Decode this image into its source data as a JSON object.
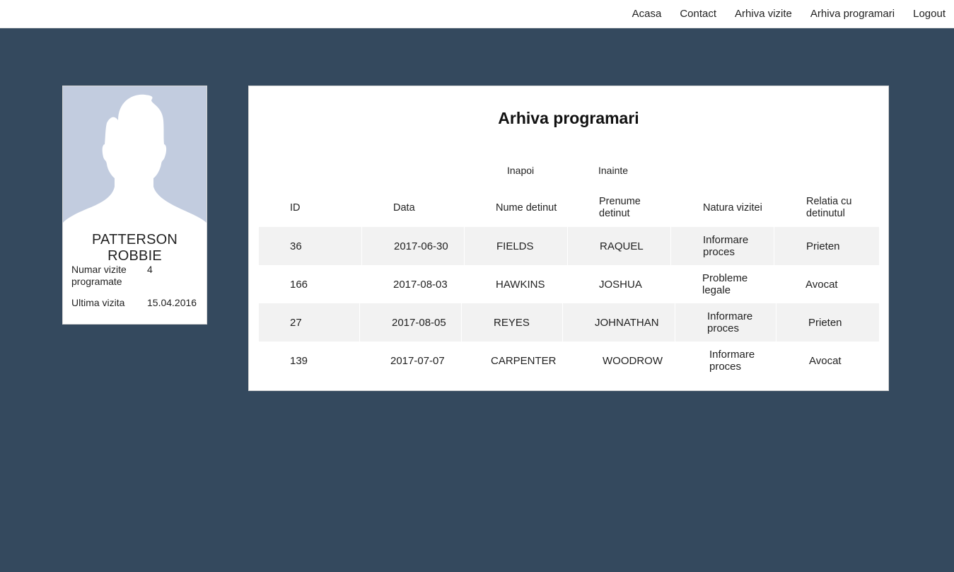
{
  "nav": {
    "items": [
      "Acasa",
      "Contact",
      "Arhiva vizite",
      "Arhiva programari",
      "Logout"
    ]
  },
  "profile": {
    "name": "PATTERSON ROBBIE",
    "stats": [
      {
        "label": "Numar vizite programate",
        "value": "4"
      },
      {
        "label": "Ultima vizita",
        "value": "15.04.2016"
      }
    ]
  },
  "panel": {
    "title": "Arhiva programari",
    "prev_label": "Inapoi",
    "next_label": "Inainte",
    "columns": [
      "ID",
      "Data",
      "Nume detinut",
      "Prenume detinut",
      "Natura vizitei",
      "Relatia cu detinutul"
    ],
    "rows": [
      [
        "36",
        "2017-06-30",
        "FIELDS",
        "RAQUEL",
        "Informare proces",
        "Prieten"
      ],
      [
        "166",
        "2017-08-03",
        "HAWKINS",
        "JOSHUA",
        "Probleme legale",
        "Avocat"
      ],
      [
        "27",
        "2017-08-05",
        "REYES",
        "JOHNATHAN",
        "Informare proces",
        "Prieten"
      ],
      [
        "139",
        "2017-07-07",
        "CARPENTER",
        "WOODROW",
        "Informare proces",
        "Avocat"
      ]
    ]
  },
  "colors": {
    "background": "#34495e",
    "avatar_bg": "#c2ccdf",
    "row_shade": "#f2f2f2"
  }
}
